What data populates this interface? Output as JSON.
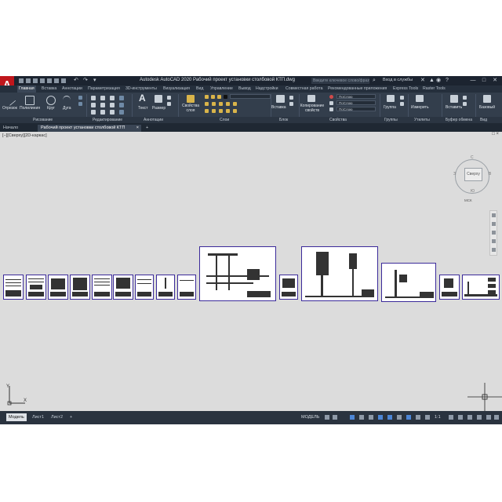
{
  "titlebar": {
    "logo_letter": "A",
    "window_title": "Autodesk AutoCAD 2020   Рабочий проект установки столбовой КТП.dwg",
    "search_placeholder": "Введите ключевое слово/фразу",
    "sign_in": "Вход в службы",
    "minimize": "—",
    "maximize": "□",
    "close": "✕"
  },
  "ribbon_tabs": [
    "Главная",
    "Вставка",
    "Аннотации",
    "Параметризация",
    "3D-инструменты",
    "Визуализация",
    "Вид",
    "Управление",
    "Вывод",
    "Надстройки",
    "Совместная работа",
    "Рекомендованные приложения",
    "Express Tools",
    "Raster Tools"
  ],
  "ribbon": {
    "draw": {
      "line": "Отрезок",
      "polyline": "Полилиния",
      "circle": "Круг",
      "arc": "Дуга"
    },
    "annotation": {
      "text": "Текст",
      "dimension": "Размер"
    },
    "layers": {
      "layer_props": "Свойства слоя"
    },
    "block": {
      "insert": "Вставка"
    },
    "properties": {
      "match": "Копирование свойств",
      "bylayer_1": "ПоСлою",
      "bylayer_2": "ПоСлою",
      "bylayer_3": "ПоСлою"
    },
    "groups": {
      "group": "Группа"
    },
    "utilities": {
      "measure": "Измерить"
    },
    "clipboard": {
      "paste": "Вставить"
    },
    "view": {
      "base": "Базовый"
    }
  },
  "panel_labels": [
    "Рисование",
    "Редактирование",
    "Аннотации",
    "Слои",
    "Блок",
    "Свойства",
    "Группы",
    "Утилиты",
    "Буфер обмена",
    "Вид"
  ],
  "file_tabs": {
    "start": "Начало",
    "document": "Рабочий проект установки столбовой КТП",
    "close": "×",
    "add": "+"
  },
  "viewport": {
    "label": "[−][Сверху][2D-каркас]"
  },
  "viewcube": {
    "face": "Сверху",
    "north": "С",
    "south": "Ю",
    "west": "З",
    "east": "В",
    "wcs": "МСК"
  },
  "ucs": {
    "x": "X",
    "y": "Y"
  },
  "status": {
    "model_tab": "Модель",
    "layout1": "Лист1",
    "layout2": "Лист2",
    "add": "+",
    "model": "МОДЕЛЬ",
    "scale": "1:1"
  }
}
